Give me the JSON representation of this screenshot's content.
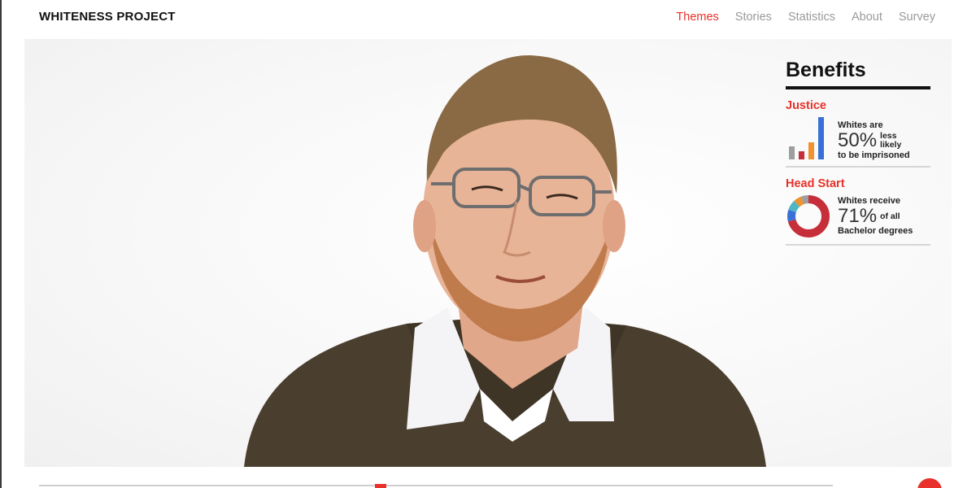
{
  "site": {
    "brand": "WHITENESS PROJECT"
  },
  "nav": {
    "items": [
      {
        "label": "Themes",
        "active": true
      },
      {
        "label": "Stories",
        "active": false
      },
      {
        "label": "Statistics",
        "active": false
      },
      {
        "label": "About",
        "active": false
      },
      {
        "label": "Survey",
        "active": false
      }
    ]
  },
  "panel": {
    "title": "Benefits",
    "justice": {
      "heading": "Justice",
      "line1": "Whites are",
      "value": "50%",
      "side1": "less",
      "side2": "likely",
      "line3": "to be imprisoned",
      "bars": [
        {
          "value": 0.3,
          "color": "#9e9e9e"
        },
        {
          "value": 0.2,
          "color": "#c62f3a"
        },
        {
          "value": 0.4,
          "color": "#f0922e"
        },
        {
          "value": 1.0,
          "color": "#3b6fd8"
        }
      ]
    },
    "headstart": {
      "heading": "Head Start",
      "line1": "Whites receive",
      "value": "71%",
      "side1": "of all",
      "line3": "Bachelor degrees",
      "donut": [
        {
          "value": 0.71,
          "color": "#c62f3a"
        },
        {
          "value": 0.09,
          "color": "#3b6fd8"
        },
        {
          "value": 0.08,
          "color": "#4fb7c4"
        },
        {
          "value": 0.06,
          "color": "#f0922e"
        },
        {
          "value": 0.06,
          "color": "#9e9e9e"
        }
      ]
    }
  },
  "player": {
    "progress": 0.43
  },
  "colors": {
    "accent": "#e8312a",
    "muted_nav": "#9a9a9a"
  },
  "icons": {
    "play": "play-button-icon"
  }
}
